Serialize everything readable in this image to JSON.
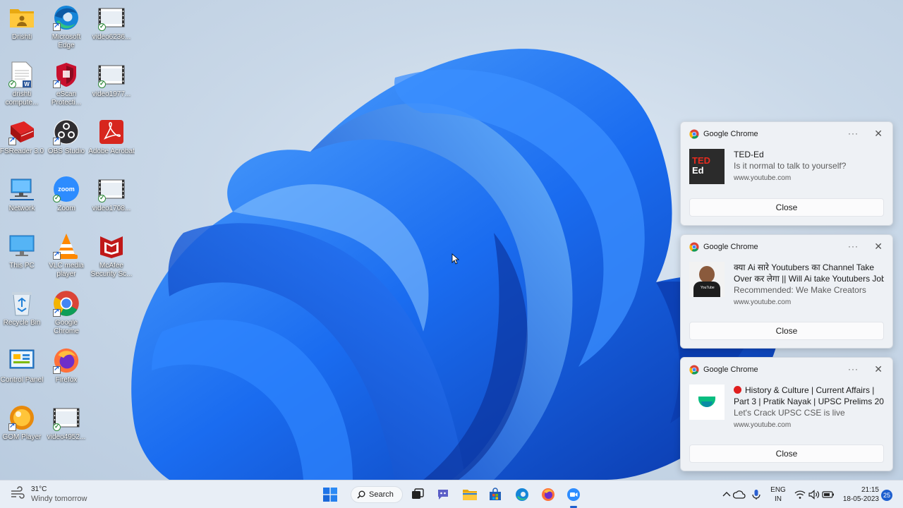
{
  "colors": {
    "accent": "#1e5fcf",
    "bloom_dark": "#0b3fb5",
    "bloom_mid": "#1a6cf0",
    "bloom_light": "#4ea3ff",
    "toast_bg": "#eef1f5"
  },
  "desktop_icons": [
    {
      "id": "drishti",
      "label": "Drishti",
      "icon": "folder-user-icon",
      "badge": "none"
    },
    {
      "id": "edge",
      "label": "Microsoft Edge",
      "icon": "edge-icon",
      "badge": "shortcut"
    },
    {
      "id": "video6236",
      "label": "video6236...",
      "icon": "video-file-icon",
      "badge": "synced"
    },
    {
      "id": "drishti-computer",
      "label": "drishti compute...",
      "icon": "word-doc-icon",
      "badge": "synced"
    },
    {
      "id": "escan",
      "label": "eScan Protecti...",
      "icon": "escan-shield-icon",
      "badge": "shortcut"
    },
    {
      "id": "video1977",
      "label": "video1977...",
      "icon": "video-file-icon",
      "badge": "synced"
    },
    {
      "id": "fsreader",
      "label": "FSReader 3.0",
      "icon": "red-book-icon",
      "badge": "shortcut"
    },
    {
      "id": "obs",
      "label": "OBS Studio",
      "icon": "obs-icon",
      "badge": "shortcut"
    },
    {
      "id": "acrobat",
      "label": "Adobe Acrobat",
      "icon": "acrobat-icon",
      "badge": "none"
    },
    {
      "id": "network",
      "label": "Network",
      "icon": "network-icon",
      "badge": "none"
    },
    {
      "id": "zoom",
      "label": "Zoom",
      "icon": "zoom-icon",
      "badge": "synced"
    },
    {
      "id": "video1708",
      "label": "video1708...",
      "icon": "video-file-icon",
      "badge": "synced"
    },
    {
      "id": "this-pc",
      "label": "This PC",
      "icon": "monitor-icon",
      "badge": "none"
    },
    {
      "id": "vlc",
      "label": "VLC media player",
      "icon": "vlc-icon",
      "badge": "shortcut"
    },
    {
      "id": "mcafee",
      "label": "McAfee Security Sc...",
      "icon": "mcafee-icon",
      "badge": "none"
    },
    {
      "id": "recycle-bin",
      "label": "Recycle Bin",
      "icon": "recycle-bin-icon",
      "badge": "none"
    },
    {
      "id": "chrome",
      "label": "Google Chrome",
      "icon": "chrome-icon",
      "badge": "shortcut"
    },
    {
      "id": "control-panel",
      "label": "Control Panel",
      "icon": "control-panel-icon",
      "badge": "none"
    },
    {
      "id": "firefox",
      "label": "Firefox",
      "icon": "firefox-icon",
      "badge": "shortcut"
    },
    {
      "id": "gom",
      "label": "GOM Player",
      "icon": "gom-icon",
      "badge": "shortcut"
    },
    {
      "id": "video4952",
      "label": "video4952...",
      "icon": "video-file-icon",
      "badge": "synced"
    }
  ],
  "notifications": [
    {
      "app": "Google Chrome",
      "title": "TED-Ed",
      "subtitle": "Is it normal to talk to yourself?",
      "url": "www.youtube.com",
      "thumb_text_1": "TED",
      "thumb_text_2": "Ed",
      "more": "···",
      "close_x": "✕",
      "button": "Close"
    },
    {
      "app": "Google Chrome",
      "title": "क्या Ai सारे Youtubers का Channel Take",
      "title_line2": "Over कर लेगा || Will Ai take Youtubers Jobs",
      "subtitle": "Recommended: We Make Creators",
      "url": "www.youtube.com",
      "thumb_text_1": "YouTube",
      "more": "···",
      "close_x": "✕",
      "button": "Close"
    },
    {
      "app": "Google Chrome",
      "title": "History & Culture | Current Affairs |",
      "title_line2": "Part 3 | Pratik Nayak | UPSC Prelims 2023",
      "subtitle": "Let's Crack UPSC CSE is live",
      "url": "www.youtube.com",
      "more": "···",
      "close_x": "✕",
      "button": "Close"
    }
  ],
  "taskbar": {
    "weather_temp": "31°C",
    "weather_desc": "Windy tomorrow",
    "search_label": "Search",
    "lang_1": "ENG",
    "lang_2": "IN",
    "time": "21:15",
    "date": "18-05-2023",
    "notification_count": "25",
    "pinned": [
      "start-icon",
      "search-icon",
      "task-view-icon",
      "teams-chat-icon",
      "file-explorer-icon",
      "store-icon",
      "edge-icon",
      "firefox-icon",
      "zoom-icon"
    ],
    "tray": [
      "chevron-up-icon",
      "onedrive-icon",
      "microphone-icon",
      "wifi-icon",
      "speaker-icon",
      "battery-icon"
    ]
  }
}
